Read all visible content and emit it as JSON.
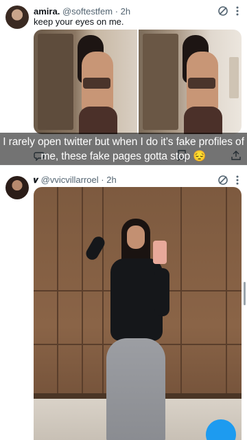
{
  "tweets": [
    {
      "name": "amira.",
      "handle": "@softestfem",
      "time": "· 2h",
      "text": "keep your eyes on me.",
      "grok_icon": "grok-icon",
      "more_icon": "more-vertical-icon"
    },
    {
      "name": "𝒗",
      "handle": "@vvicvillarroel",
      "time": "· 2h",
      "grok_icon": "grok-icon",
      "more_icon": "more-vertical-icon"
    }
  ],
  "caption": {
    "line1": "I rarely open twitter but when I do it’s fake profiles of",
    "line2": "me, these fake pages gotta stop 😔"
  },
  "colors": {
    "accent": "#1d9bf0",
    "muted": "#536471",
    "text": "#0f1419"
  }
}
